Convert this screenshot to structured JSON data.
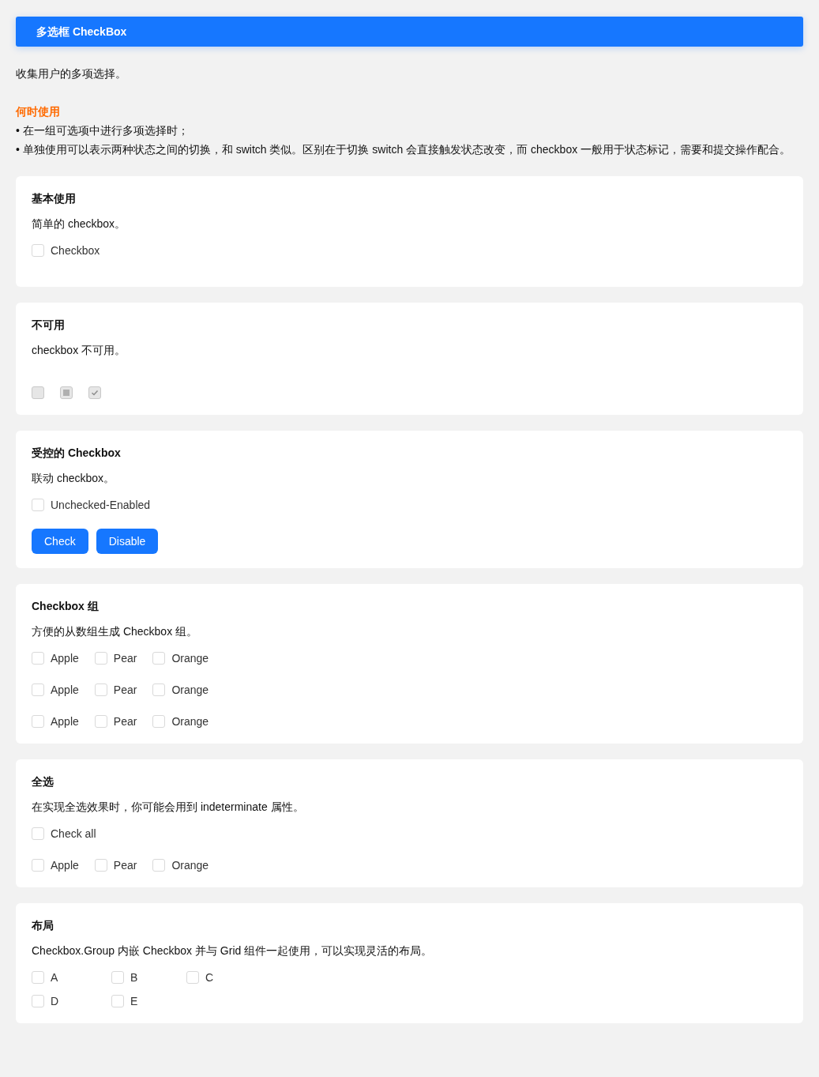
{
  "header": {
    "title": "多选框 CheckBox"
  },
  "intro": "收集用户的多项选择。",
  "when_to_use": {
    "heading": "何时使用",
    "bullets": [
      "• 在一组可选项中进行多项选择时；",
      "• 单独使用可以表示两种状态之间的切换，和 switch 类似。区别在于切换 switch 会直接触发状态改变，而 checkbox 一般用于状态标记，需要和提交操作配合。"
    ]
  },
  "sections": [
    {
      "title": "基本使用",
      "description": "简单的 checkbox。",
      "kind": "inline",
      "rows": [
        [
          {
            "label": "Checkbox",
            "checked": false,
            "disabled": false
          }
        ]
      ]
    },
    {
      "title": "不可用",
      "description": "checkbox 不可用。",
      "kind": "inline",
      "rows": [
        [
          {
            "checked": false,
            "disabled": true
          },
          {
            "checked": false,
            "indeterminate": true,
            "disabled": true
          },
          {
            "checked": true,
            "disabled": true
          }
        ]
      ]
    },
    {
      "title": "受控的 Checkbox",
      "description": "联动 checkbox。",
      "kind": "inline",
      "rows": [
        [
          {
            "label": "Unchecked-Enabled",
            "checked": false,
            "disabled": false
          }
        ]
      ],
      "buttons": [
        "Check",
        "Disable"
      ]
    },
    {
      "title": "Checkbox 组",
      "description": "方便的从数组生成 Checkbox 组。",
      "kind": "inline",
      "rows": [
        [
          {
            "label": "Apple",
            "checked": false,
            "disabled": false
          },
          {
            "label": "Pear",
            "checked": false,
            "disabled": false
          },
          {
            "label": "Orange",
            "checked": false,
            "disabled": false
          }
        ],
        [
          {
            "label": "Apple",
            "checked": false,
            "disabled": false
          },
          {
            "label": "Pear",
            "checked": false,
            "disabled": false
          },
          {
            "label": "Orange",
            "checked": false,
            "disabled": false
          }
        ],
        [
          {
            "label": "Apple",
            "checked": false,
            "disabled": false
          },
          {
            "label": "Pear",
            "checked": false,
            "disabled": false
          },
          {
            "label": "Orange",
            "checked": false,
            "disabled": false
          }
        ]
      ]
    },
    {
      "title": "全选",
      "description": "在实现全选效果时，你可能会用到 indeterminate 属性。",
      "kind": "inline",
      "rows": [
        [
          {
            "label": "Check all",
            "checked": false,
            "disabled": false
          }
        ],
        [
          {
            "label": "Apple",
            "checked": false,
            "disabled": false
          },
          {
            "label": "Pear",
            "checked": false,
            "disabled": false
          },
          {
            "label": "Orange",
            "checked": false,
            "disabled": false
          }
        ]
      ]
    },
    {
      "title": "布局",
      "description": "Checkbox.Group 内嵌 Checkbox 并与 Grid 组件一起使用，可以实现灵活的布局。",
      "kind": "grid",
      "rows": [
        [
          {
            "label": "A",
            "checked": false,
            "disabled": false
          },
          {
            "label": "B",
            "checked": false,
            "disabled": false
          },
          {
            "label": "C",
            "checked": false,
            "disabled": false
          }
        ],
        [
          {
            "label": "D",
            "checked": false,
            "disabled": false
          },
          {
            "label": "E",
            "checked": false,
            "disabled": false
          }
        ]
      ]
    }
  ]
}
